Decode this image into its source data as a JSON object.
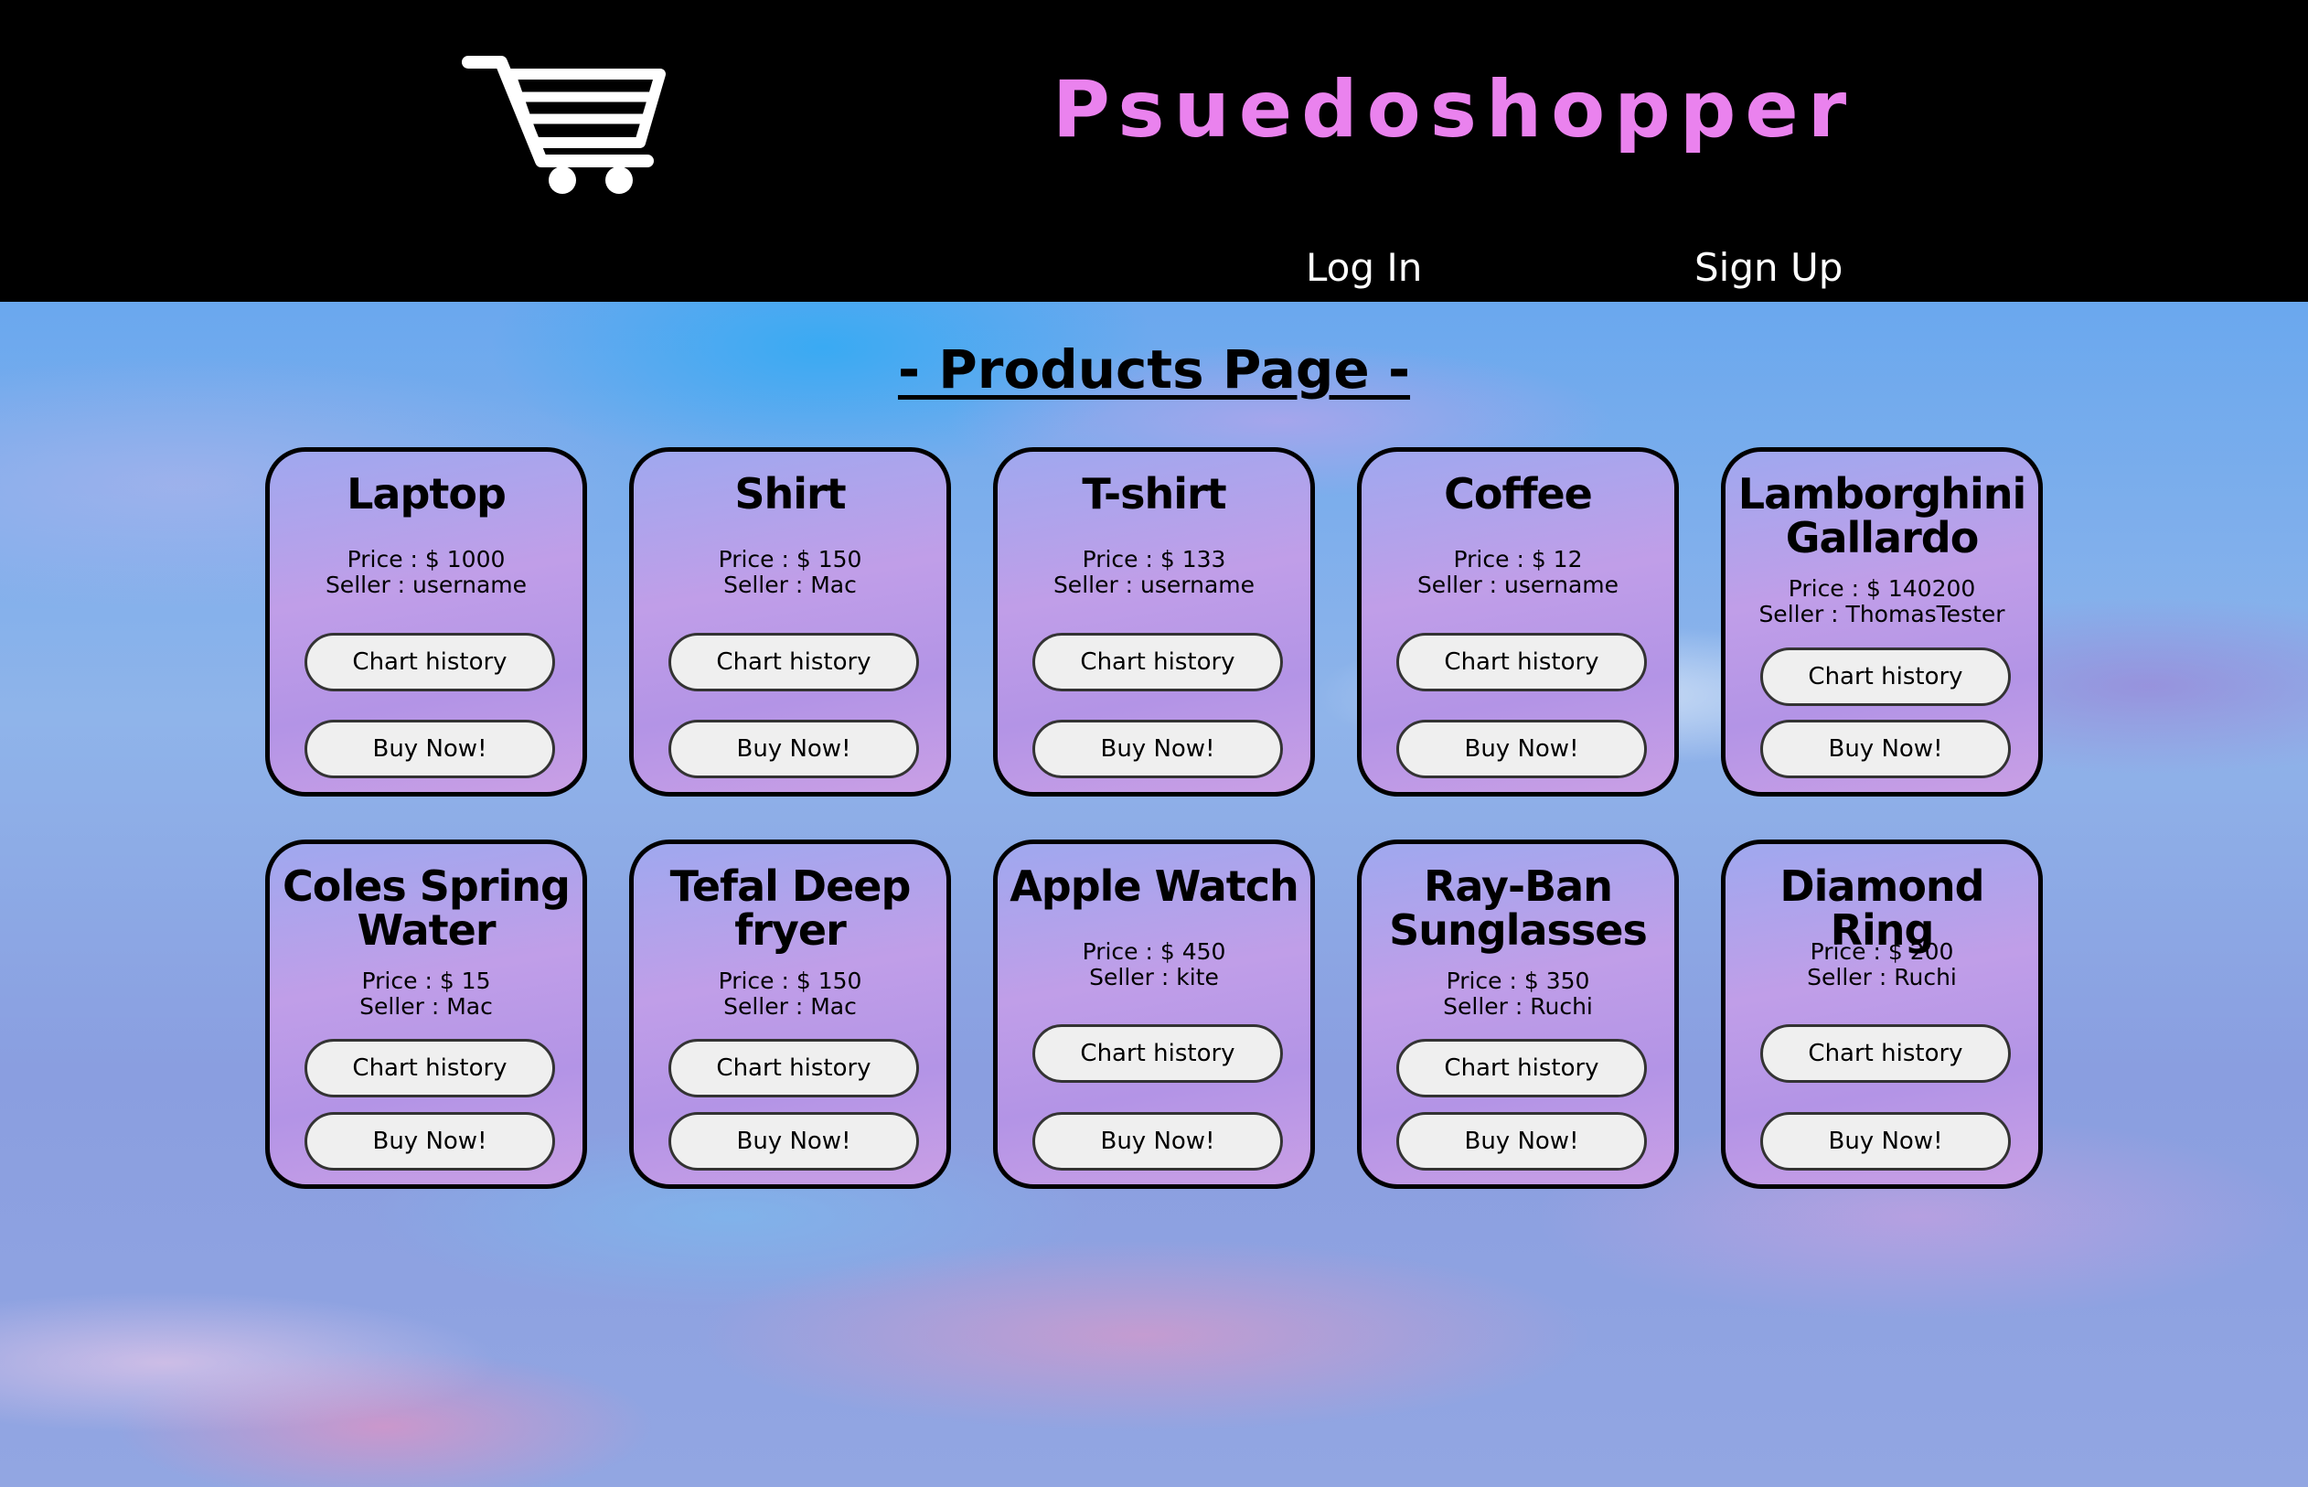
{
  "header": {
    "logo_icon": "shopping-cart-icon",
    "site_title": "Psuedoshopper",
    "nav": {
      "login_label": "Log In",
      "signup_label": "Sign Up"
    },
    "title_color": "#ea82ee"
  },
  "main": {
    "heading": "- Products Page -",
    "buttons": {
      "chart_history": "Chart history",
      "buy_now": "Buy Now!"
    },
    "products": [
      {
        "name": "Laptop",
        "price": "Price : $ 1000",
        "seller": "Seller : username"
      },
      {
        "name": "Shirt",
        "price": "Price : $ 150",
        "seller": "Seller : Mac"
      },
      {
        "name": "T-shirt",
        "price": "Price : $ 133",
        "seller": "Seller : username"
      },
      {
        "name": "Coffee",
        "price": "Price : $ 12",
        "seller": "Seller : username"
      },
      {
        "name_lines": [
          "Lamborghini",
          "Gallardo"
        ],
        "price": "Price : $ 140200",
        "seller": "Seller : ThomasTester"
      },
      {
        "name_lines": [
          "Coles Spring",
          "Water"
        ],
        "price": "Price : $ 15",
        "seller": "Seller : Mac"
      },
      {
        "name_lines": [
          "Tefal Deep",
          "fryer"
        ],
        "price": "Price : $ 150",
        "seller": "Seller : Mac"
      },
      {
        "name": "Apple Watch",
        "price": "Price : $ 450",
        "seller": "Seller : kite"
      },
      {
        "name_lines": [
          "Ray-Ban",
          "Sunglasses"
        ],
        "price": "Price : $ 350",
        "seller": "Seller : Ruchi"
      },
      {
        "name": "Diamond Ring",
        "price": "Price : $ 200",
        "seller": "Seller : Ruchi"
      }
    ]
  }
}
